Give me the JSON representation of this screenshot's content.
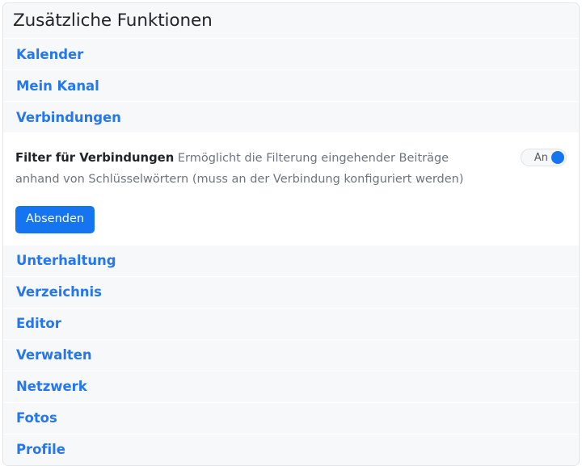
{
  "panel": {
    "title": "Zusätzliche Funktionen"
  },
  "rows_before": [
    {
      "label": "Kalender"
    },
    {
      "label": "Mein Kanal"
    }
  ],
  "expanded_row": {
    "label": "Verbindungen"
  },
  "setting": {
    "name": "Filter für Verbindungen",
    "description": "Ermöglicht die Filterung eingehender Beiträge anhand von Schlüsselwörtern (muss an der Verbindung konfiguriert werden)",
    "toggle": {
      "state_label": "An",
      "enabled": true,
      "knob_color": "#1575f0"
    },
    "submit_label": "Absenden"
  },
  "rows_after": [
    {
      "label": "Unterhaltung"
    },
    {
      "label": "Verzeichnis"
    },
    {
      "label": "Editor"
    },
    {
      "label": "Verwalten"
    },
    {
      "label": "Netzwerk"
    },
    {
      "label": "Fotos"
    },
    {
      "label": "Profile"
    }
  ],
  "colors": {
    "link": "#2577f0",
    "accent": "#1575f0",
    "row_background": "#f7f8fa",
    "panel_background": "#ffffff",
    "heading": "#212529",
    "muted_text": "#6c757d"
  }
}
